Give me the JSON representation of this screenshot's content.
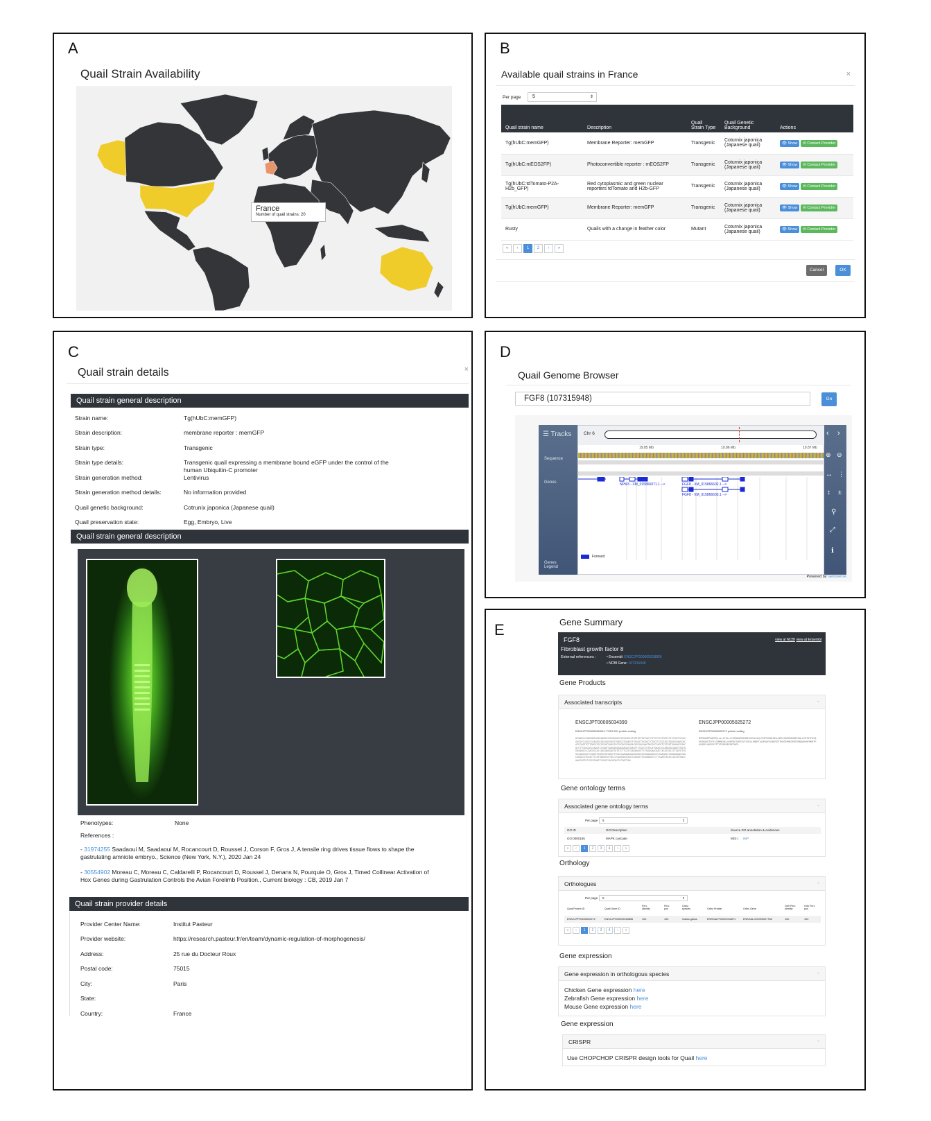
{
  "panels": {
    "a": "A",
    "b": "B",
    "c": "C",
    "d": "D",
    "e": "E"
  },
  "panel_a": {
    "title": "Quail Strain Availability",
    "tooltip_country": "France",
    "tooltip_text": "Number of quail strains: 20",
    "colors": {
      "land": "#333538",
      "available": "#efcc2a",
      "selected": "#e8956b",
      "ocean": "#f1f1f1"
    }
  },
  "panel_b": {
    "title": "Available quail strains in France",
    "close": "×",
    "per_page_label": "Per page",
    "per_page_value": "5",
    "headers": [
      "Quail strain name",
      "Description",
      "Quail Strain Type",
      "Quail Genetic Background",
      "Actions"
    ],
    "rows": [
      [
        "Tg(hUbC:memGFP)",
        "Membrane Reporter: memGFP",
        "Transgenic",
        "Coturnix japonica (Japanese quail)"
      ],
      [
        "Tg(hUbC:mEOS2FP)",
        "Photoconvertible reporter : mEOS2FP",
        "Transgenic",
        "Coturnix japonica (Japanese quail)"
      ],
      [
        "Tg(hUbC:tdTomato-P2A-H2b_GFP)",
        "Red cytoplasmic and green nuclear reporters tdTomato and H2b-GFP",
        "Transgenic",
        "Coturnix japonica (Japanese quail)"
      ],
      [
        "Tg(hUbC:memGFP)",
        "Membrane Reporter: memGFP",
        "Transgenic",
        "Coturnix japonica (Japanese quail)"
      ],
      [
        "Rusty",
        "Quails with a change in feather color",
        "Mutant",
        "Coturnix japonica (Japanese quail)"
      ]
    ],
    "show_label": "Show",
    "contact_label": "Contact Provider",
    "pager": [
      "«",
      "‹",
      "1",
      "2",
      "›",
      "»"
    ],
    "cancel": "Cancel",
    "ok": "OK"
  },
  "panel_c": {
    "title": "Quail strain details",
    "close": "×",
    "section1": "Quail strain general description",
    "fields": [
      [
        "Strain name:",
        "Tg(hUbC:memGFP)"
      ],
      [
        "Strain description:",
        "membrane reporter : memGFP"
      ],
      [
        "Strain type:",
        "Transgenic"
      ],
      [
        "Strain type details:",
        "Transgenic quail expressing a membrane bound eGFP under the control of the human Ubiquitin-C promoter"
      ],
      [
        "Strain generation method:",
        "Lentivirus"
      ],
      [
        "Strain generation method details:",
        "No information provided"
      ],
      [
        "Quail genetic background:",
        "Cotrunix japonica (Japanese quail)"
      ],
      [
        "Quail preservation state:",
        "Egg, Embryo, Live"
      ]
    ],
    "section2": "Quail strain general description",
    "phenotypes_label": "Phenotypes:",
    "phenotypes_value": "None",
    "references_label": "References :",
    "ref1_id": "31974255",
    "ref1_text": "Saadaoui M, Saadaoui M, Rocancourt D, Roussel J, Corson F, Gros J, A tensile ring drives tissue flows to shape the gastrulating amniote embryo., Science (New York, N.Y.), 2020 Jan 24",
    "ref2_id": "30554902",
    "ref2_text": "Moreau C, Moreau C, Caldarelli P, Rocancourt D, Roussel J, Denans N, Pourquie O, Gros J, Timed Collinear Activation of Hox Genes during Gastrulation Controls the Avian Forelimb Position., Current biology : CB, 2019 Jan 7",
    "section3": "Quail strain provider details",
    "provider": [
      [
        "Provider Center Name:",
        "Institut Pasteur"
      ],
      [
        "Provider website:",
        "https://research.pasteur.fr/en/team/dynamic-regulation-of-morphogenesis/"
      ],
      [
        "Address:",
        "25 rue du Docteur Roux"
      ],
      [
        "Postal code:",
        "75015"
      ],
      [
        "City:",
        "Paris"
      ],
      [
        "State:",
        ""
      ],
      [
        "Country:",
        "France"
      ]
    ]
  },
  "panel_d": {
    "title": "Quail Genome Browser",
    "search_value": "FGF8 (107315948)",
    "go": "Go",
    "tracks": "Tracks",
    "chr": "Chr 6",
    "scale": [
      "19.85 Mb",
      "19.86 Mb",
      "19.87 Mb"
    ],
    "track_sequence": "Sequence",
    "track_genes": "Genes",
    "track_legend": "Genes Legend",
    "gene1": "NPM3 - XM_015866971.1 -->",
    "gene2": "FGF8 - XM_015866602.1 -->",
    "gene3": "FGF8 - XM_015866603.1 -->",
    "legend_forward": "Forward",
    "powered_by": "Powered by",
    "powered_name": "Genoverse"
  },
  "panel_e": {
    "title": "Gene Summary",
    "gene": "FGF8",
    "gene_desc": "Fibroblast growth factor 8",
    "ext_refs": "External references :",
    "ensembl_label": "Ensembl:",
    "ensembl_id": "ENSCJPG00005018856",
    "ncbi_label": "NCBI Gene:",
    "ncbi_id": "107315948",
    "view_ncbi": "view at NCBI",
    "view_ensembl": "view at Ensembl",
    "gene_products": "Gene Products",
    "assoc_transcripts": "Associated transcripts",
    "tx1_id": "ENSCJPT00005034399",
    "tx1_sub": "ENSCJPT00005034399.1 FGF8-201 protein coding",
    "tx1_seq": "ATGAGCCCGAGGGCGGGCAGGCCCGCGCAGCCGCGCGGCCTGCTGCTGCTGCTCTTCTCCCTGCTCCTCTGCTCCCGCGGCGCCCAGCCGCAGGGCAGCGACGACGTGAGCGTGAAGCTGCAGCTGCAGCTCTACTCCCGCACCGGGGGCAAGCACATCCAGGTCCTGGGCCGCCGCATCAGCGCCCGCGGCGAGGACGGCGACAAGTACGCCCAGCTCCTGGTGGAGACCGACACCTTCGGCAGCCAAGTCCGGATCAAGGGGAAGGAGACGGAGTTCTACCTGTGCATGAACCGCAAGGGCAAGCTGGTGGGGAAGCCCGACGGCACCAGCAAGGAGTGTGTCTTCATCGAGAAGGTTCTGGAGAACAACTACACGGCCCTGATGTCGGCCAAGTACTCGGGCTGGTACGTGGGCTTCACCAAGAAGGGGCGGCCGCGGAAGGGCCCCAAGACCCGGGAGAACCAGCAGGACGTGCACTTCATGAAGCGCTACCCCAAGGGGCAGCCGGAGCTGCAGAAGCCCTTCAAGTACACCACGGTGACCAAGCGGTCCCGCCGGATCCGGCCCACGCACCCCGGCTAG",
    "tx2_id": "ENSCJPP00005025272",
    "tx2_sub": "ENSCJPP00005025272 protein coding",
    "tx2_seq": "MSPRAGRPAQPRGLLLLLFSLLLCSRGAQPQGSDDVSVKLQLQLYSRTGGKHIQVLGRRISARGEDGDKYAQLLVETDTFGSQVRIKGKETEFYLCMNRKGKLVGKPDGTSKECVFIEKVLENNYTALMSAKYSGWYVGFTKKGRPRKGPKTRENQQDVHFMKRYPKGQPELQKPFKYTTVTKRSRRIRPTHPG",
    "go_terms": "Gene ontology terms",
    "assoc_go": "Associated gene ontology terms",
    "per_page_label": "Per page",
    "per_page_value": "5",
    "go_headers": [
      "GO ID",
      "GO Description",
      "Source GO annotation & evidences"
    ],
    "go_row": [
      "GO:0000165",
      "MAPK cascade",
      "MGI |",
      "IMP"
    ],
    "go_pager": [
      "«",
      "‹",
      "1",
      "2",
      "3",
      "4",
      "›",
      "»"
    ],
    "orthology": "Orthology",
    "orthologues": "Orthologues",
    "ortho_headers": [
      "Quail Protein ID",
      "Quail Gene ID",
      "Perc Identity",
      "Perc pos",
      "Ortho species",
      "Ortho Protein",
      "Ortho Gene",
      "Orth Perc identity",
      "Orth Perc pos"
    ],
    "ortho_row": [
      "ENSCJPP00005025272",
      "ENSCJPG00005018856",
      "100",
      "100",
      "Gallus gallus",
      "ENSGALP00000032871",
      "ENSGALG00000007758",
      "100",
      "100"
    ],
    "ortho_pager": [
      "«",
      "‹",
      "1",
      "2",
      "3",
      "4",
      "›",
      "»"
    ],
    "gene_expression": "Gene expression",
    "expr_ortho": "Gene expression in orthologous species",
    "chicken": "Chicken Gene expression",
    "zebrafish": "Zebrafish Gene expression",
    "mouse": "Mouse Gene expression",
    "here": "here",
    "gene_expression2": "Gene expression",
    "crispr": "CRISPR",
    "crispr_text": "Use CHOPCHOP CRISPR design tools for Quail"
  }
}
